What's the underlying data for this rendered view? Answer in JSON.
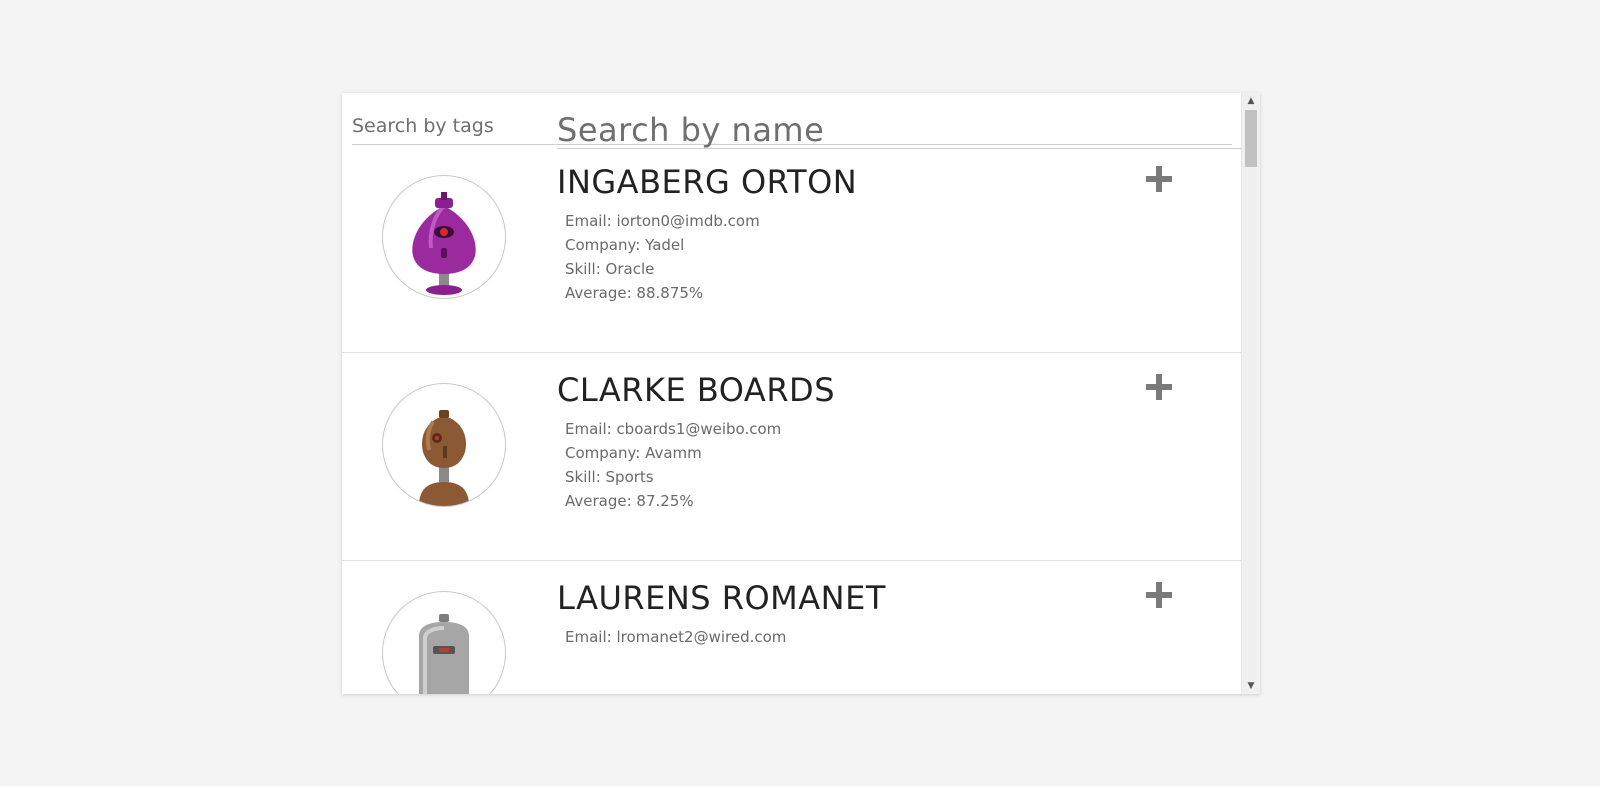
{
  "search": {
    "name_placeholder": "Search by name",
    "tags_placeholder": "Search by tags"
  },
  "students": [
    {
      "name": "INGABERG ORTON",
      "email": "Email: iorton0@imdb.com",
      "company": "Company: Yadel",
      "skill": "Skill: Oracle",
      "average": "Average: 88.875%",
      "avatar_color": "#9b2a9e",
      "avatar_icon": "robot-avatar-purple"
    },
    {
      "name": "CLARKE BOARDS",
      "email": "Email: cboards1@weibo.com",
      "company": "Company: Avamm",
      "skill": "Skill: Sports",
      "average": "Average: 87.25%",
      "avatar_color": "#8b5a34",
      "avatar_icon": "robot-avatar-brown"
    },
    {
      "name": "LAURENS ROMANET",
      "email": "Email: lromanet2@wired.com",
      "company": "",
      "skill": "",
      "average": "",
      "avatar_color": "#9a9a9a",
      "avatar_icon": "robot-avatar-gray"
    }
  ],
  "icons": {
    "expand": "plus-icon",
    "scroll_up": "chevron-up-icon",
    "scroll_down": "chevron-down-icon"
  },
  "colors": {
    "page_bg": "#f4f4f4",
    "card_bg": "#ffffff",
    "plus": "#7a7a7a"
  }
}
